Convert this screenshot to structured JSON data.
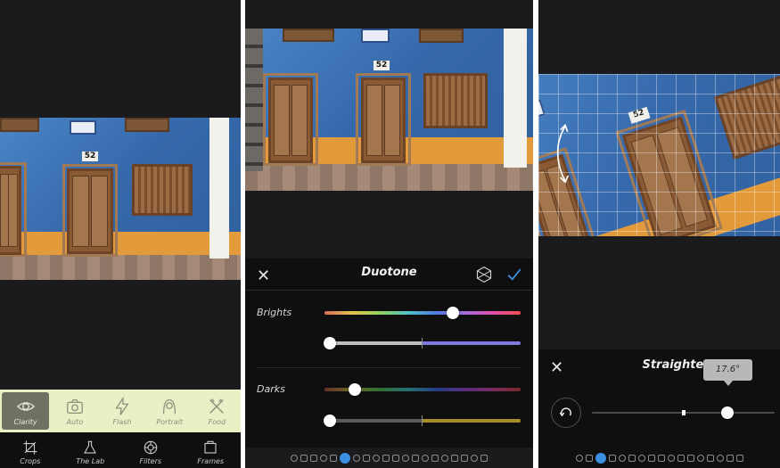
{
  "screen1": {
    "photo": {
      "house_number": "52"
    },
    "filters": [
      {
        "label": "Clarity",
        "icon": "eye-icon",
        "active": true
      },
      {
        "label": "Auto",
        "icon": "camera-icon",
        "active": false
      },
      {
        "label": "Flash",
        "icon": "lightning-icon",
        "active": false
      },
      {
        "label": "Portrait",
        "icon": "portrait-icon",
        "active": false
      },
      {
        "label": "Food",
        "icon": "fork-knife-icon",
        "active": false
      }
    ],
    "tools": [
      {
        "label": "Crops",
        "icon": "crop-icon"
      },
      {
        "label": "The Lab",
        "icon": "flask-icon"
      },
      {
        "label": "Filters",
        "icon": "filters-icon"
      },
      {
        "label": "Frames",
        "icon": "frame-icon"
      }
    ]
  },
  "screen2": {
    "title": "Duotone",
    "photo": {
      "house_number": "52"
    },
    "sections": [
      {
        "label": "Brights",
        "hue": 0.66,
        "balance": 0.0
      },
      {
        "label": "Darks",
        "hue": 0.16,
        "balance": 0.0
      }
    ],
    "colors": {
      "accent": "#3d8fe2",
      "panel": "#0f0f10"
    }
  },
  "screen3": {
    "title": "Straighten",
    "angle_label": "17.6°",
    "angle_value": 17.6,
    "photo": {
      "house_number": "52"
    }
  }
}
